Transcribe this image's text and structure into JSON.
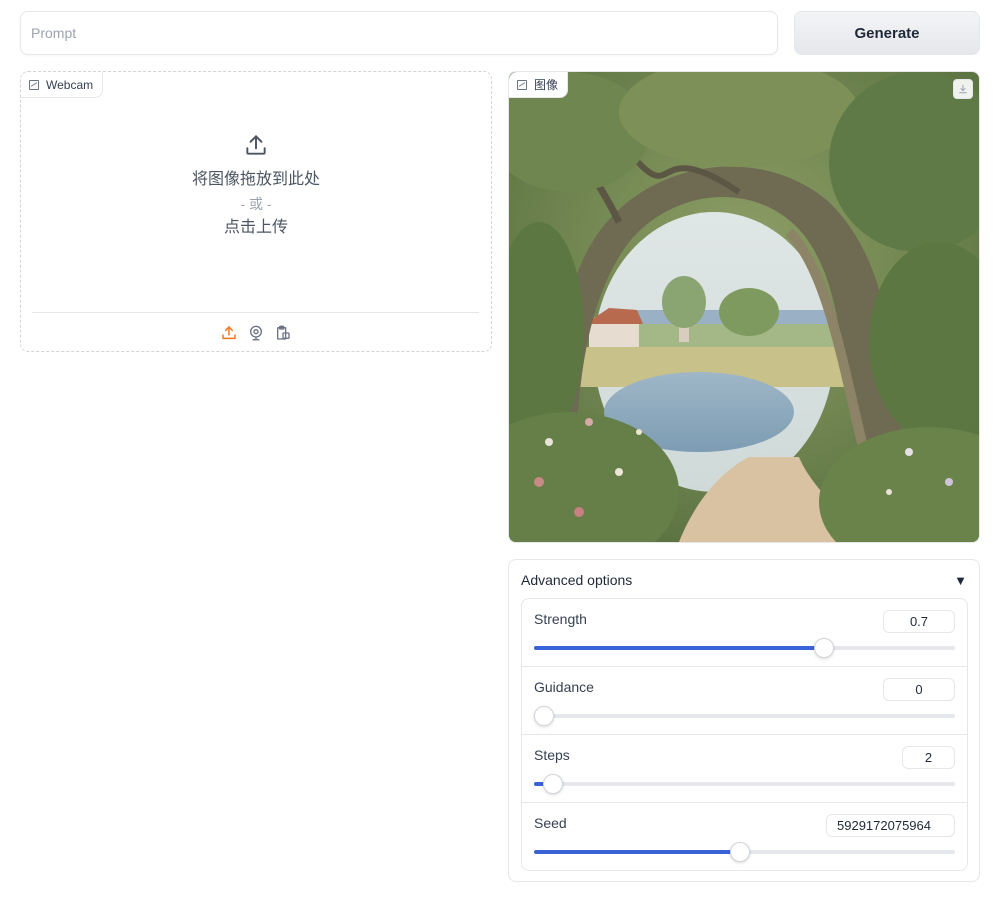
{
  "prompt": {
    "placeholder": "Prompt",
    "value": ""
  },
  "generate_button": {
    "label": "Generate"
  },
  "input_panel": {
    "tag_label": "Webcam",
    "drop_text": "将图像拖放到此处",
    "or_text": "- 或 -",
    "click_text": "点击上传",
    "sources": [
      "upload-icon",
      "webcam-icon",
      "clipboard-icon"
    ],
    "active_color": "#f97316"
  },
  "output_panel": {
    "tag_label": "图像",
    "download_icon": "download-icon"
  },
  "advanced": {
    "title": "Advanced options",
    "caret": "▼",
    "accent": "#3b63d8",
    "sliders": [
      {
        "label": "Strength",
        "value": "0.7",
        "fraction": 0.69
      },
      {
        "label": "Guidance",
        "value": "0",
        "fraction": 0.0
      },
      {
        "label": "Steps",
        "value": "2",
        "fraction": 0.045
      },
      {
        "label": "Seed",
        "value": "5929172075964",
        "fraction": 0.49
      }
    ]
  }
}
